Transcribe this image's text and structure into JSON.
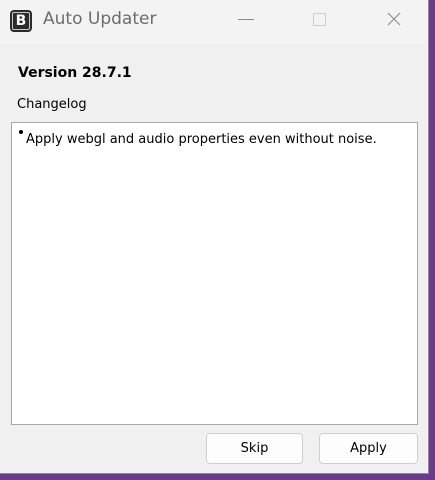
{
  "window": {
    "title": "Auto Updater",
    "icon_letter": "B",
    "controls": {
      "minimize_icon": "minimize-icon",
      "maximize_icon": "maximize-icon",
      "close_icon": "close-icon",
      "close_glyph": "✕"
    }
  },
  "content": {
    "version": "Version 28.7.1",
    "changelog_label": "Changelog",
    "changelog_items": [
      "Apply webgl and audio properties even without noise."
    ]
  },
  "buttons": {
    "skip_label": "Skip",
    "apply_label": "Apply"
  },
  "colors": {
    "desktop_accent": "#6a3a8c",
    "window_bg": "#f0f0f0",
    "text": "#000000"
  }
}
